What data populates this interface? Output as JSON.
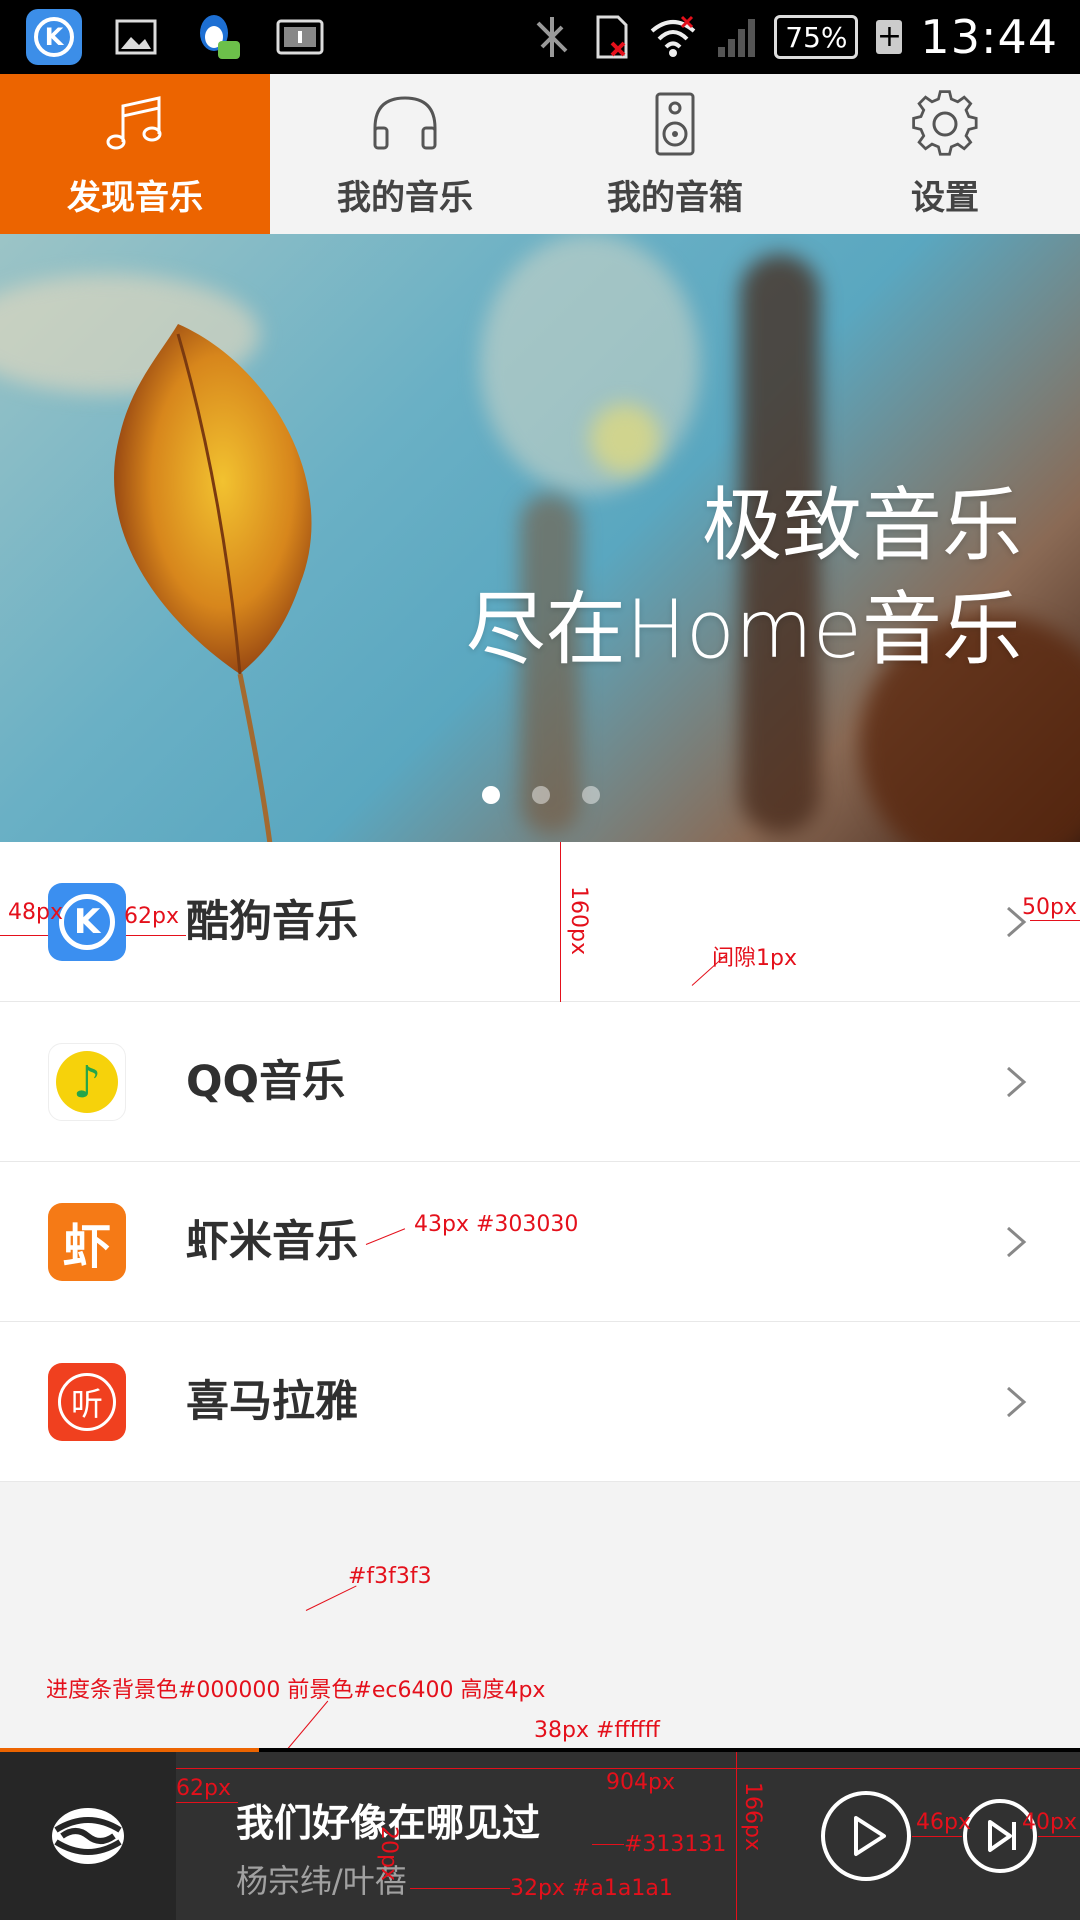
{
  "status_bar": {
    "battery": "75%",
    "charging": "+",
    "time": "13:44",
    "kugou_letter": "K"
  },
  "tabs": [
    {
      "label": "发现音乐",
      "icon": "music-note-icon",
      "active": true
    },
    {
      "label": "我的音乐",
      "icon": "headphones-icon",
      "active": false
    },
    {
      "label": "我的音箱",
      "icon": "speaker-icon",
      "active": false
    },
    {
      "label": "设置",
      "icon": "gear-icon",
      "active": false
    }
  ],
  "banner": {
    "line1": "极致音乐",
    "line2": "尽在Home音乐",
    "active_dot": 0,
    "dot_count": 3
  },
  "apps": [
    {
      "label": "酷狗音乐",
      "icon": "kugou-icon",
      "badge": "K"
    },
    {
      "label": "QQ音乐",
      "icon": "qq-music-icon",
      "badge": "♪"
    },
    {
      "label": "虾米音乐",
      "icon": "xiami-icon",
      "badge": "虾"
    },
    {
      "label": "喜马拉雅",
      "icon": "ximalaya-icon",
      "badge": "听"
    }
  ],
  "annotations": {
    "a48": "48px",
    "a62": "62px",
    "a160": "160px",
    "gap": "间隙1px",
    "a50": "50px",
    "font43": "43px #303030",
    "bg": "#f3f3f3",
    "progress_note": "进度条背景色#000000 前景色#ec6400 高度4px",
    "title_note": "38px #ffffff",
    "p62": "62px",
    "w904": "904px",
    "h166": "166px",
    "g20": "20px",
    "bg313131": "#313131",
    "artist_note": "32px #a1a1a1",
    "p46": "46px",
    "p40": "40px"
  },
  "progress": {
    "value": 0.24
  },
  "player": {
    "title": "我们好像在哪见过",
    "artist": "杨宗纬/叶蓓"
  },
  "colors": {
    "accent": "#ec6400",
    "background": "#f3f3f3",
    "player_bg": "#313131",
    "text": "#303030",
    "artist": "#a1a1a1"
  }
}
